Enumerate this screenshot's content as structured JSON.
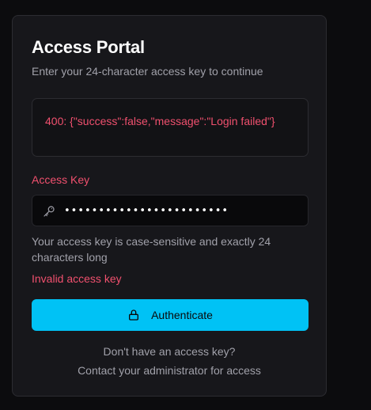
{
  "portal": {
    "title": "Access Portal",
    "subtitle": "Enter your 24-character access key to continue"
  },
  "error_alert": {
    "message": "400: {\"success\":false,\"message\":\"Login failed\"}"
  },
  "access_key": {
    "label": "Access Key",
    "value": "••••••••••••••••••••••••",
    "helper": "Your access key is case-sensitive and exactly 24 characters long",
    "validation_error": "Invalid access key",
    "icon": "key-icon"
  },
  "authenticate_button": {
    "label": "Authenticate",
    "icon": "lock-icon"
  },
  "footer": {
    "question": "Don't have an access key?",
    "contact": "Contact your administrator for access"
  },
  "colors": {
    "background": "#0c0c0e",
    "card": "#17171b",
    "error": "#f0506e",
    "accent": "#00c2f5",
    "muted_text": "#a1a1aa"
  }
}
